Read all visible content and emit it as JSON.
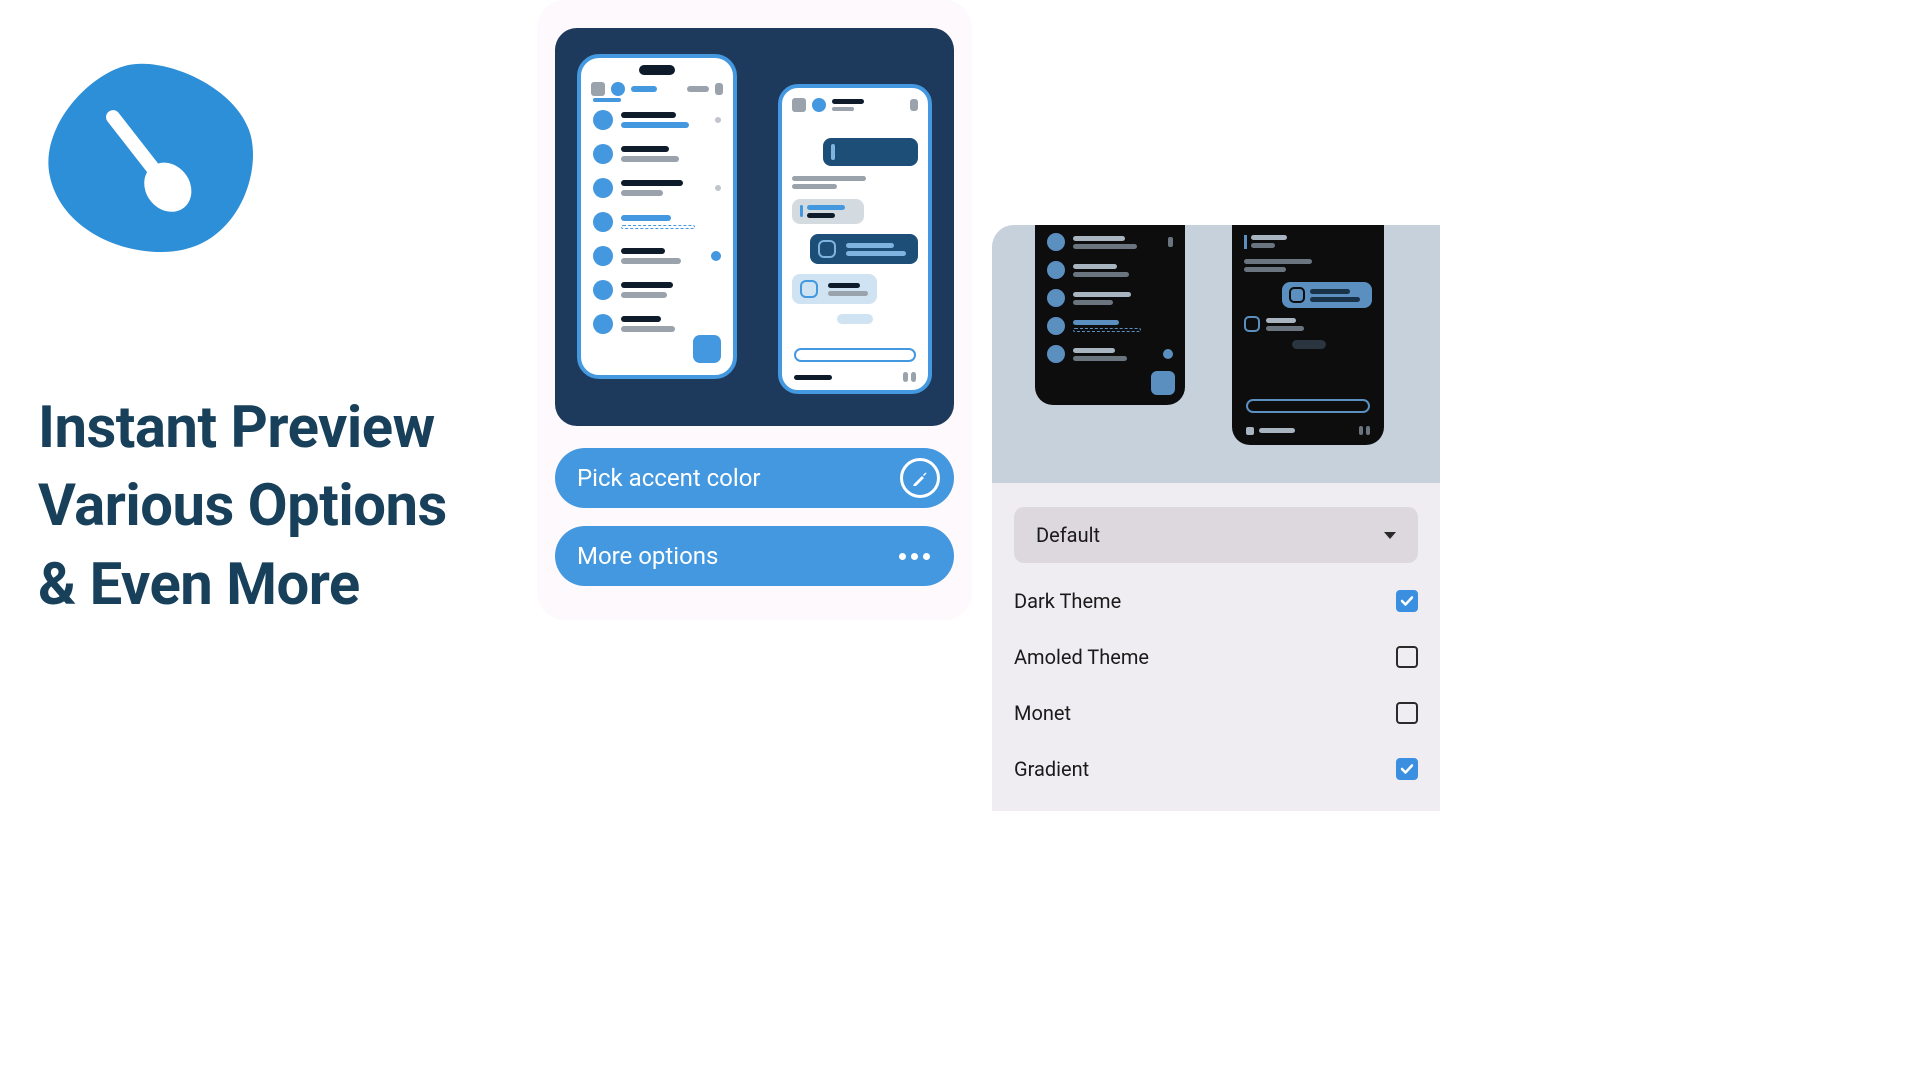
{
  "headline": {
    "line1": "Instant Preview",
    "line2": "Various Options",
    "line3": "& Even More"
  },
  "actions": {
    "pick_accent": "Pick accent color",
    "more_options": "More options"
  },
  "settings": {
    "dropdown_value": "Default",
    "options": [
      {
        "label": "Dark Theme",
        "checked": true
      },
      {
        "label": "Amoled Theme",
        "checked": false
      },
      {
        "label": "Monet",
        "checked": false
      },
      {
        "label": "Gradient",
        "checked": true
      }
    ]
  },
  "colors": {
    "accent": "#4398df",
    "dark_navy": "#1d3a5c",
    "headline": "#18405a"
  }
}
